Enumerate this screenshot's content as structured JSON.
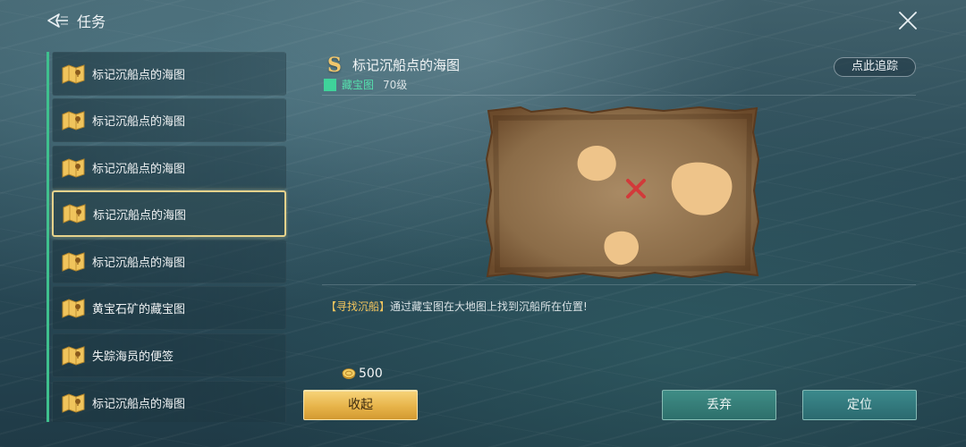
{
  "header": {
    "title": "任务"
  },
  "tasks": [
    {
      "label": "标记沉船点的海图",
      "selected": false
    },
    {
      "label": "标记沉船点的海图",
      "selected": false
    },
    {
      "label": "标记沉船点的海图",
      "selected": false
    },
    {
      "label": "标记沉船点的海图",
      "selected": true
    },
    {
      "label": "标记沉船点的海图",
      "selected": false
    },
    {
      "label": "黄宝石矿的藏宝图",
      "selected": false
    },
    {
      "label": "失踪海员的便签",
      "selected": false
    },
    {
      "label": "标记沉船点的海图",
      "selected": false
    }
  ],
  "detail": {
    "rank": "S",
    "title": "标记沉船点的海图",
    "track_label": "点此追踪",
    "type_label": "藏宝图",
    "type_color": "#3fd39a",
    "level": "70级",
    "desc_tag": "【寻找沉船】",
    "desc_text": "通过藏宝图在大地图上找到沉船所在位置!"
  },
  "reward": {
    "icon": "coin-icon",
    "amount": "500"
  },
  "buttons": {
    "collapse": "收起",
    "abandon": "丢弃",
    "locate": "定位"
  },
  "colors": {
    "accent_green": "#3fc08e",
    "gold": "#f0c66c",
    "selected_border": "#e6d28c"
  }
}
